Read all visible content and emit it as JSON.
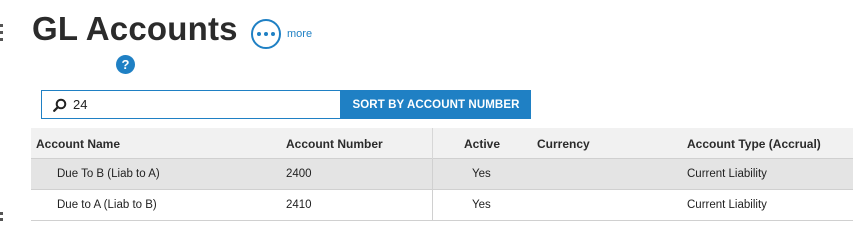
{
  "header": {
    "title": "GL Accounts",
    "more_label": "more",
    "help_glyph": "?"
  },
  "icons": {
    "more": "ellipsis-icon",
    "help": "question-icon",
    "search": "search-icon"
  },
  "search": {
    "value": "24",
    "placeholder": ""
  },
  "sort_button": {
    "label": "SORT BY ACCOUNT NUMBER"
  },
  "colors": {
    "accent": "#1f80c4",
    "header_bg": "#f1f1f1",
    "row_alt_bg": "#e4e4e4"
  },
  "table": {
    "columns": [
      "Account Name",
      "Account Number",
      "Active",
      "Currency",
      "Account Type (Accrual)"
    ],
    "rows": [
      [
        "Due To B (Liab to A)",
        "2400",
        "Yes",
        "",
        "Current Liability"
      ],
      [
        "Due to A (Liab to B)",
        "2410",
        "Yes",
        "",
        "Current Liability"
      ]
    ]
  }
}
